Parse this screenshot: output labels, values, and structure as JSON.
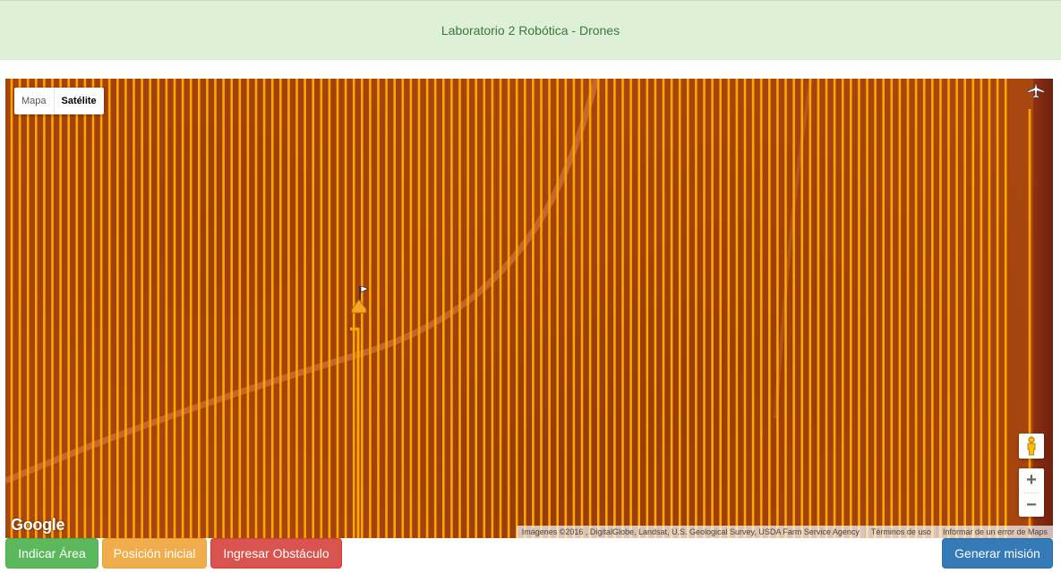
{
  "header": {
    "title": "Laboratorio 2 Robótica - Drones"
  },
  "map": {
    "map_types": [
      {
        "label": "Mapa",
        "active": false
      },
      {
        "label": "Satélite",
        "active": true
      }
    ],
    "zoom": {
      "in_label": "+",
      "out_label": "−"
    },
    "logo": "Google",
    "attribution": {
      "imagery": "Imágenes ©2016 , DigitalGlobe, Landsat, U.S. Geological Survey, USDA Farm Service Agency",
      "terms": "Términos de uso",
      "report": "Informar de un error de Maps"
    },
    "path_color": "#ffa500",
    "icons": {
      "start": "home-flag-icon",
      "drone": "plane-icon",
      "pegman": "pegman-icon"
    }
  },
  "buttons": {
    "area": "Indicar Área",
    "position": "Posición inicial",
    "obstacle": "Ingresar Obstáculo",
    "generate": "Generar misión"
  }
}
